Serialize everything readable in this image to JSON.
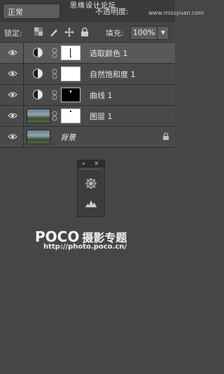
{
  "header": {
    "blend_mode": "正常",
    "opacity_label": "不透明度:",
    "watermark_line1": "思缘设计论坛",
    "watermark_line2": "www.missyuan.com"
  },
  "lock_bar": {
    "lock_label": "锁定:",
    "fill_label": "填充:",
    "fill_value": "100%"
  },
  "layers": [
    {
      "name": "选取颜色 1",
      "type": "adjustment",
      "selected": true
    },
    {
      "name": "自然饱和度 1",
      "type": "adjustment",
      "selected": false
    },
    {
      "name": "曲线 1",
      "type": "adjustment",
      "selected": false
    },
    {
      "name": "图层 1",
      "type": "pixel-with-mask",
      "selected": false
    },
    {
      "name": "背景",
      "type": "background-locked",
      "selected": false
    }
  ],
  "brand": {
    "logo_text": "POCO",
    "logo_suffix": "摄影专题",
    "url": "http://photo.poco.cn/"
  },
  "icons": [
    "eye-icon",
    "chain-icon",
    "lock-icon",
    "compass-icon",
    "histogram-icon"
  ]
}
